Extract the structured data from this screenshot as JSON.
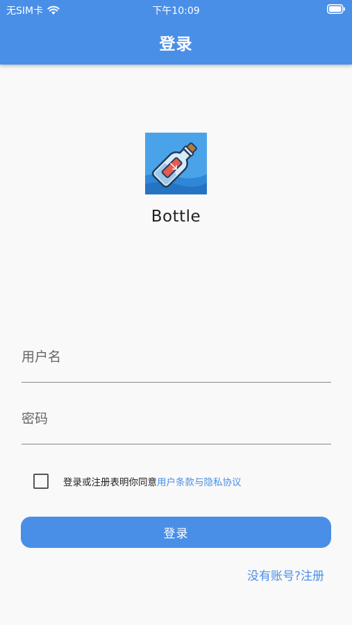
{
  "status_bar": {
    "carrier": "无SIM卡",
    "time": "下午10:09",
    "wifi_icon": "wifi-icon",
    "battery_icon": "battery-icon"
  },
  "app_bar": {
    "title": "登录",
    "color": "#4a8fe7"
  },
  "logo": {
    "icon": "bottle-logo-icon",
    "name": "Bottle"
  },
  "form": {
    "username_placeholder": "用户名",
    "username_value": "",
    "password_placeholder": "密码",
    "password_value": ""
  },
  "agreement": {
    "checked": false,
    "text": "登录或注册表明你同意",
    "link": "用户条款与隐私协议"
  },
  "login_button": "登录",
  "register_link": "没有账号?注册"
}
